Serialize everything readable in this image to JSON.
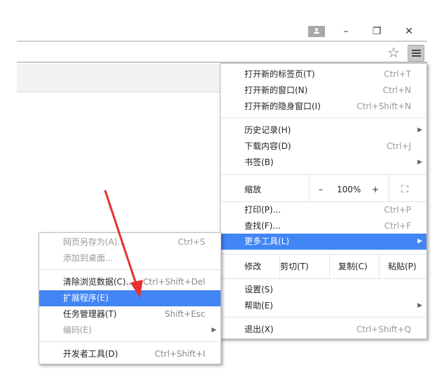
{
  "window": {
    "minimize": "–",
    "restore": "❐",
    "close": "✕"
  },
  "toolbar": {
    "star": "☆"
  },
  "menu": {
    "group1": [
      {
        "label": "打开新的标签页(T)",
        "shortcut": "Ctrl+T"
      },
      {
        "label": "打开新的窗口(N)",
        "shortcut": "Ctrl+N"
      },
      {
        "label": "打开新的隐身窗口(I)",
        "shortcut": "Ctrl+Shift+N"
      }
    ],
    "group2": [
      {
        "label": "历史记录(H)",
        "shortcut": "",
        "submenu": true
      },
      {
        "label": "下载内容(D)",
        "shortcut": "Ctrl+J"
      },
      {
        "label": "书签(B)",
        "shortcut": "",
        "submenu": true
      }
    ],
    "zoom": {
      "label": "缩放",
      "minus": "–",
      "value": "100%",
      "plus": "+",
      "fullscreen": "⛶"
    },
    "group3": [
      {
        "label": "打印(P)...",
        "shortcut": "Ctrl+P"
      },
      {
        "label": "查找(F)...",
        "shortcut": "Ctrl+F"
      },
      {
        "label": "更多工具(L)",
        "shortcut": "",
        "submenu": true,
        "highlighted": true
      }
    ],
    "edit": {
      "label": "修改",
      "cut": "剪切(T)",
      "copy": "复制(C)",
      "paste": "粘贴(P)"
    },
    "group4": [
      {
        "label": "设置(S)",
        "shortcut": ""
      },
      {
        "label": "帮助(E)",
        "shortcut": "",
        "submenu": true
      }
    ],
    "exit": {
      "label": "退出(X)",
      "shortcut": "Ctrl+Shift+Q"
    }
  },
  "submenu": {
    "group1": [
      {
        "label": "网页另存为(A)...",
        "shortcut": "Ctrl+S",
        "disabled": true
      },
      {
        "label": "添加到桌面...",
        "shortcut": "",
        "disabled": true
      }
    ],
    "group2": [
      {
        "label": "清除浏览数据(C)...",
        "shortcut": "Ctrl+Shift+Del"
      },
      {
        "label": "扩展程序(E)",
        "shortcut": "",
        "highlighted": true
      },
      {
        "label": "任务管理器(T)",
        "shortcut": "Shift+Esc"
      },
      {
        "label": "编码(E)",
        "shortcut": "",
        "disabled": true,
        "submenu": true
      }
    ],
    "group3": [
      {
        "label": "开发者工具(D)",
        "shortcut": "Ctrl+Shift+I"
      }
    ]
  },
  "colors": {
    "highlight": "#4285f4",
    "annotation_arrow": "#e8312f"
  }
}
